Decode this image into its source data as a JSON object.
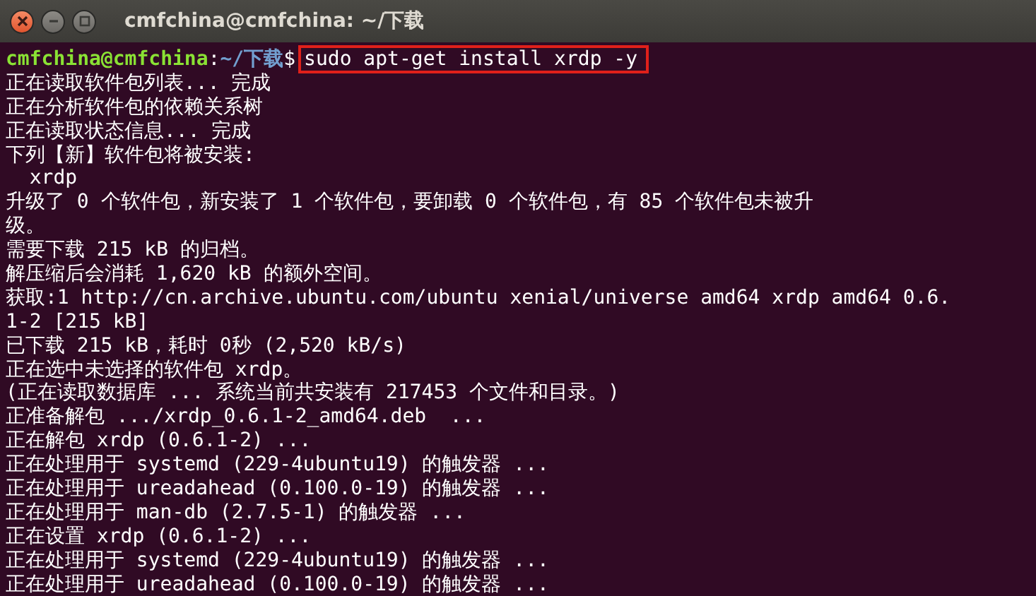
{
  "window": {
    "title": "cmfchina@cmfchina: ~/下载"
  },
  "prompt": {
    "user_host": "cmfchina@cmfchina",
    "separator": ":",
    "path": "~/下载",
    "symbol": "$",
    "command": "sudo apt-get install xrdp -y"
  },
  "output": [
    "正在读取软件包列表... 完成",
    "正在分析软件包的依赖关系树",
    "正在读取状态信息... 完成",
    "下列【新】软件包将被安装:",
    "  xrdp",
    "升级了 0 个软件包，新安装了 1 个软件包，要卸载 0 个软件包，有 85 个软件包未被升",
    "级。",
    "需要下载 215 kB 的归档。",
    "解压缩后会消耗 1,620 kB 的额外空间。",
    "获取:1 http://cn.archive.ubuntu.com/ubuntu xenial/universe amd64 xrdp amd64 0.6.",
    "1-2 [215 kB]",
    "已下载 215 kB，耗时 0秒 (2,520 kB/s)",
    "正在选中未选择的软件包 xrdp。",
    "(正在读取数据库 ... 系统当前共安装有 217453 个文件和目录。)",
    "正准备解包 .../xrdp_0.6.1-2_amd64.deb  ...",
    "正在解包 xrdp (0.6.1-2) ...",
    "正在处理用于 systemd (229-4ubuntu19) 的触发器 ...",
    "正在处理用于 ureadahead (0.100.0-19) 的触发器 ...",
    "正在处理用于 man-db (2.7.5-1) 的触发器 ...",
    "正在设置 xrdp (0.6.1-2) ...",
    "正在处理用于 systemd (229-4ubuntu19) 的触发器 ...",
    "正在处理用于 ureadahead (0.100.0-19) 的触发器 ..."
  ]
}
